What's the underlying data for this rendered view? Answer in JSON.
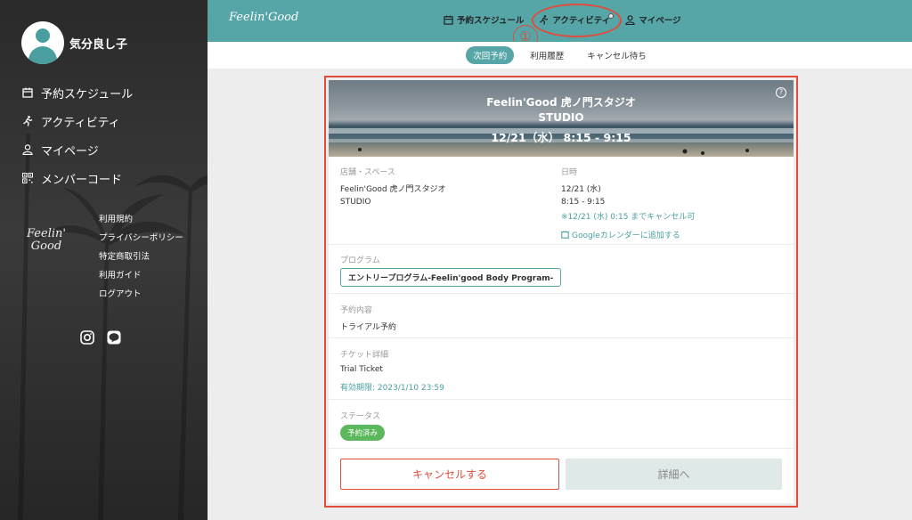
{
  "sidebar": {
    "username": "気分良し子",
    "nav": [
      {
        "label": "予約スケジュール",
        "icon": "calendar-icon"
      },
      {
        "label": "アクティビティ",
        "icon": "running-icon"
      },
      {
        "label": "マイページ",
        "icon": "user-icon"
      },
      {
        "label": "メンバーコード",
        "icon": "qr-code-icon"
      }
    ],
    "logo": [
      "Feelin'",
      "Good"
    ],
    "links": [
      "利用規約",
      "プライバシーポリシー",
      "特定商取引法",
      "利用ガイド",
      "ログアウト"
    ],
    "social": [
      "instagram-icon",
      "line-icon"
    ]
  },
  "header": {
    "brand": "Feelin'Good",
    "nav": [
      {
        "label": "予約スケジュール",
        "icon": "calendar-icon"
      },
      {
        "label": "アクティビティ",
        "icon": "running-icon"
      },
      {
        "label": "マイページ",
        "icon": "user-icon"
      }
    ],
    "annotation_marker": "①"
  },
  "subtabs": [
    {
      "label": "次回予約",
      "active": true
    },
    {
      "label": "利用履歴",
      "active": false
    },
    {
      "label": "キャンセル待ち",
      "active": false
    }
  ],
  "card": {
    "banner": {
      "studio": "Feelin'Good 虎ノ門スタジオ",
      "space": "STUDIO",
      "datetime": "12/21（水） 8:15 - 9:15"
    },
    "store": {
      "label": "店舗・スペース",
      "line1": "Feelin'Good 虎ノ門スタジオ",
      "line2": "STUDIO"
    },
    "date": {
      "label": "日時",
      "day": "12/21 (水)",
      "time": "8:15 - 9:15",
      "cancel_note": "※12/21 (水) 0:15 までキャンセル可",
      "google": "Googleカレンダーに追加する"
    },
    "program": {
      "label": "プログラム",
      "value": "エントリープログラム-Feelin'good Body Program-"
    },
    "reservation": {
      "label": "予約内容",
      "value": "トライアル予約"
    },
    "ticket": {
      "label": "チケット詳細",
      "name": "Trial Ticket",
      "expiry": "有効期限: 2023/1/10 23:59"
    },
    "status": {
      "label": "ステータス",
      "value": "予約済み"
    },
    "buttons": {
      "cancel": "キャンセルする",
      "detail": "詳細へ"
    }
  },
  "colors": {
    "accent": "#56a6a8",
    "highlight": "#e14c3c",
    "status_green": "#5cb85c"
  }
}
